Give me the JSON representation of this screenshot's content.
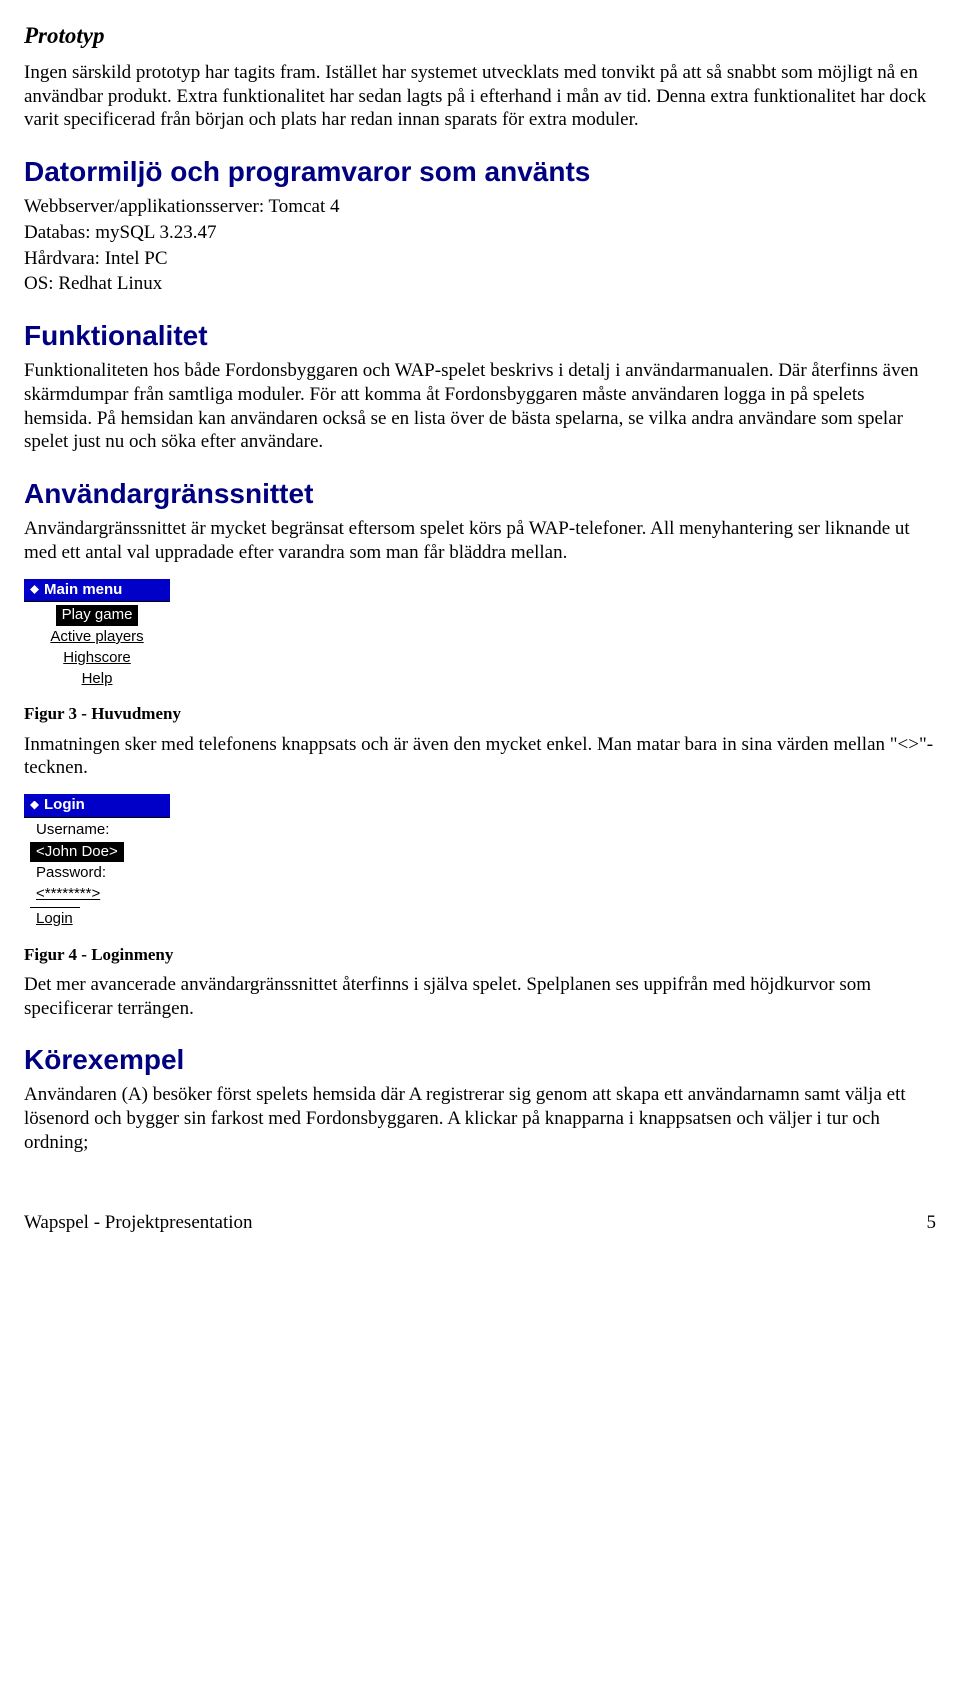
{
  "prototyp": {
    "heading": "Prototyp",
    "body": "Ingen särskild prototyp har tagits fram. Istället har systemet utvecklats med tonvikt på att så snabbt som möjligt nå en användbar produkt. Extra funktionalitet har sedan lagts på i efterhand i mån av tid. Denna extra funktionalitet har dock varit specificerad från början och plats har redan innan sparats för extra moduler."
  },
  "datormiljo": {
    "heading": "Datormiljö och programvaror som använts",
    "lines": [
      "Webbserver/applikationsserver: Tomcat 4",
      "Databas: mySQL 3.23.47",
      "Hårdvara: Intel PC",
      "OS: Redhat Linux"
    ]
  },
  "funktionalitet": {
    "heading": "Funktionalitet",
    "body": "Funktionaliteten hos både Fordonsbyggaren och WAP-spelet beskrivs i detalj i användarmanualen. Där återfinns även skärmdumpar från samtliga moduler. För att komma åt Fordonsbyggaren måste användaren logga in på spelets hemsida. På hemsidan kan användaren också se en lista över de bästa spelarna, se vilka andra användare som spelar spelet just nu och söka efter användare."
  },
  "ui": {
    "heading": "Användargränssnittet",
    "body": "Användargränssnittet är mycket begränsat eftersom spelet körs på WAP-telefoner. All menyhantering ser liknande ut med ett antal val uppradade efter varandra som man får bläddra mellan."
  },
  "wap_menu": {
    "title": "Main menu",
    "items": [
      "Play game",
      "Active players",
      "Highscore",
      "Help"
    ]
  },
  "fig3": "Figur 3 - Huvudmeny",
  "input_desc": "Inmatningen sker med telefonens knappsats och är även den mycket enkel. Man matar bara in sina värden mellan \"<>\"-tecknen.",
  "wap_login": {
    "title": "Login",
    "username_label": "Username:",
    "username_value": "<John Doe>",
    "password_label": "Password:",
    "password_value": "<********>",
    "action": "Login"
  },
  "fig4": "Figur 4 - Loginmeny",
  "adv_ui": "Det mer avancerade användargränssnittet återfinns i själva spelet. Spelplanen ses uppifrån med höjdkurvor som specificerar terrängen.",
  "korexempel": {
    "heading": "Körexempel",
    "body": "Användaren (A) besöker först spelets hemsida där A registrerar sig genom att skapa ett användarnamn samt välja ett lösenord och bygger sin farkost med Fordonsbyggaren. A klickar på knapparna i knappsatsen och väljer i tur och ordning;"
  },
  "footer": {
    "left": "Wapspel - Projektpresentation",
    "right": "5"
  }
}
